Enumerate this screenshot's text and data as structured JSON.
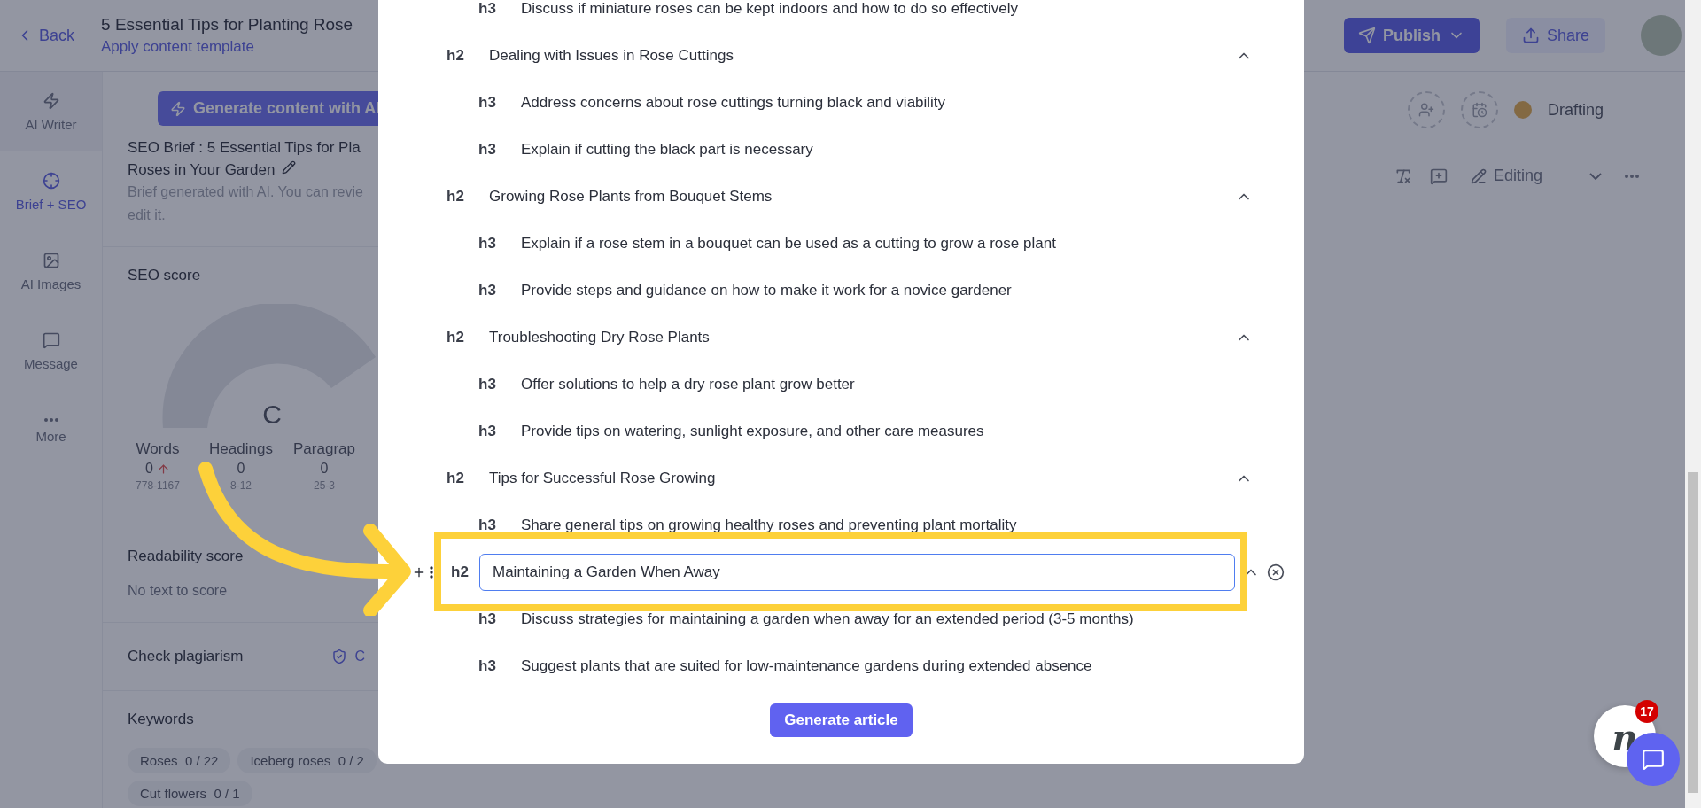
{
  "header": {
    "back": "Back",
    "title": "5 Essential Tips for Planting Rose",
    "subtitle": "Apply content template",
    "publish": "Publish",
    "share": "Share"
  },
  "nav": [
    {
      "label": "AI Writer",
      "selected": false
    },
    {
      "label": "Brief + SEO",
      "selected": true
    },
    {
      "label": "AI Images",
      "selected": false
    },
    {
      "label": "Message",
      "selected": false
    },
    {
      "label": "More",
      "selected": false
    }
  ],
  "panel": {
    "generate": "Generate content with AI",
    "brief_title": [
      "SEO Brief : 5 Essential Tips for Pla",
      "Roses in Your Garden"
    ],
    "brief_note": [
      "Brief generated with AI. You can revie",
      "edit it."
    ],
    "seo_title": "SEO score",
    "grade": "C",
    "stats": [
      {
        "label": "Words",
        "value": "0",
        "range": "778-1167",
        "trend_up": true
      },
      {
        "label": "Headings",
        "value": "0",
        "range": "8-12",
        "trend_up": false
      },
      {
        "label": "Paragrap",
        "value": "0",
        "range": "25-3",
        "trend_up": false
      }
    ],
    "readability_title": "Readability score",
    "readability_note": "No text to score",
    "plagiarism": "Check plagiarism",
    "plagiarism_link": "C",
    "keywords_title": "Keywords",
    "keywords": [
      {
        "name": "Roses",
        "count": "0 / 22"
      },
      {
        "name": "Iceberg roses",
        "count": "0 / 2"
      },
      {
        "name": "Cut flowers",
        "count": "0 / 1"
      }
    ]
  },
  "status": "Drafting",
  "mode": "Editing",
  "outline": [
    {
      "tag": "h3",
      "text": "Discuss if miniature roses can be kept indoors and how to do so effectively"
    },
    {
      "tag": "h2",
      "text": "Dealing with Issues in Rose Cuttings",
      "expanded": true,
      "editing": false
    },
    {
      "tag": "h3",
      "text": "Address concerns about rose cuttings turning black and viability"
    },
    {
      "tag": "h3",
      "text": "Explain if cutting the black part is necessary"
    },
    {
      "tag": "h2",
      "text": "Growing Rose Plants from Bouquet Stems",
      "expanded": true,
      "editing": false
    },
    {
      "tag": "h3",
      "text": "Explain if a rose stem in a bouquet can be used as a cutting to grow a rose plant"
    },
    {
      "tag": "h3",
      "text": "Provide steps and guidance on how to make it work for a novice gardener"
    },
    {
      "tag": "h2",
      "text": "Troubleshooting Dry Rose Plants",
      "expanded": true,
      "editing": false
    },
    {
      "tag": "h3",
      "text": "Offer solutions to help a dry rose plant grow better"
    },
    {
      "tag": "h3",
      "text": "Provide tips on watering, sunlight exposure, and other care measures"
    },
    {
      "tag": "h2",
      "text": "Tips for Successful Rose Growing",
      "expanded": true,
      "editing": false
    },
    {
      "tag": "h3",
      "text": "Share general tips on growing healthy roses and preventing plant mortality"
    },
    {
      "tag": "h2",
      "text": "Maintaining a Garden When Away",
      "expanded": true,
      "editing": true
    },
    {
      "tag": "h3",
      "text": "Discuss strategies for maintaining a garden when away for an extended period (3-5 months)"
    },
    {
      "tag": "h3",
      "text": "Suggest plants that are suited for low-maintenance gardens during extended absence"
    }
  ],
  "generate_article": "Generate article",
  "chat": {
    "logo": "n",
    "badge": "17"
  }
}
